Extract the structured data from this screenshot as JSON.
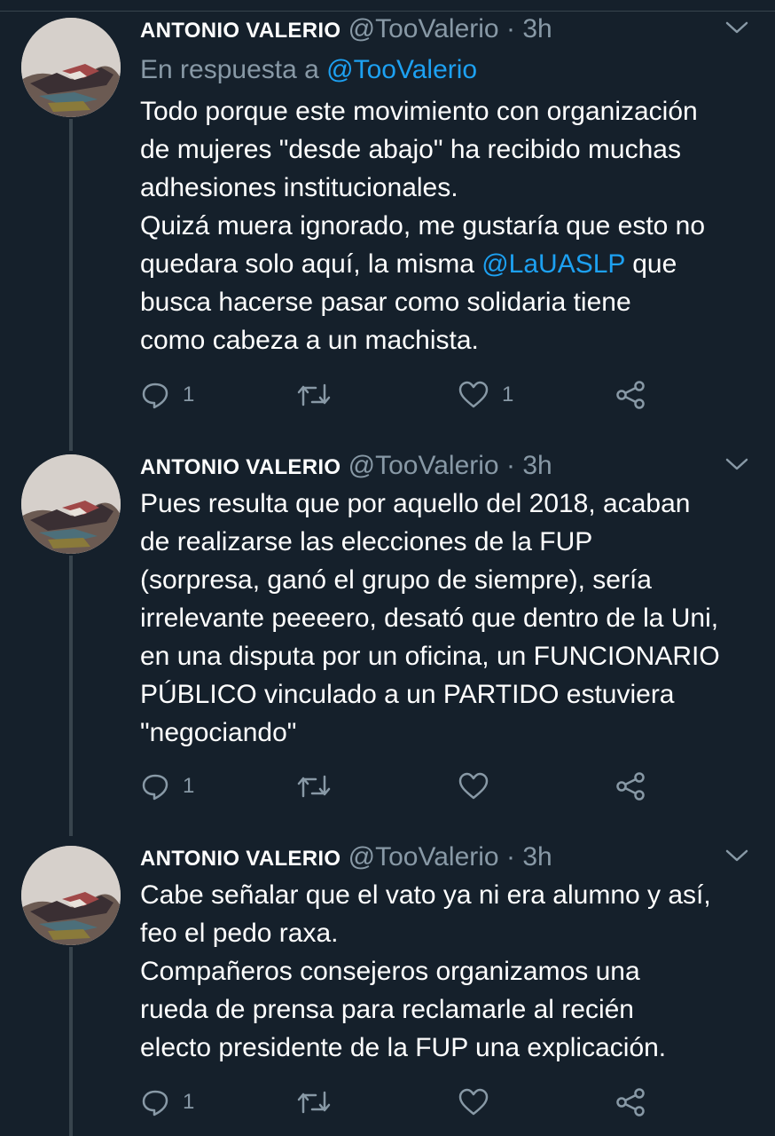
{
  "tweets": [
    {
      "author_name": "ANTONIO VALERIO",
      "handle": "@TooValerio",
      "separator": "·",
      "time": "3h",
      "reply_prefix": "En respuesta a",
      "reply_to": "@TooValerio",
      "text_part1": "Todo porque este movimiento con organización\nde mujeres \"desde abajo\" ha recibido muchas\nadhesiones institucionales.\nQuizá muera ignorado, me gustaría que esto no\nquedara solo aquí, la misma ",
      "mention": "@LaUASLP",
      "text_part2": " que\nbusca hacerse pasar como solidaria tiene\ncomo cabeza a un machista.",
      "reply_count": "1",
      "retweet_count": "",
      "like_count": "1"
    },
    {
      "author_name": "ANTONIO VALERIO",
      "handle": "@TooValerio",
      "separator": "·",
      "time": "3h",
      "text": "Pues resulta que por aquello del 2018, acaban\nde realizarse las elecciones de la FUP\n(sorpresa, ganó el grupo de siempre), sería\nirrelevante peeeero, desató que dentro de la Uni,\nen una disputa por un oficina, un FUNCIONARIO\nPÚBLICO vinculado a un PARTIDO estuviera\n\"negociando\"",
      "reply_count": "1",
      "retweet_count": "",
      "like_count": ""
    },
    {
      "author_name": "ANTONIO VALERIO",
      "handle": "@TooValerio",
      "separator": "·",
      "time": "3h",
      "text": "Cabe señalar que el vato ya ni era alumno y así,\nfeo el pedo raxa.\nCompañeros consejeros organizamos una\nrueda de prensa para reclamarle al recién\nelecto presidente de la FUP una explicación.",
      "reply_count": "1",
      "retweet_count": "",
      "like_count": ""
    }
  ],
  "icons": {
    "reply": "reply-icon",
    "retweet": "retweet-icon",
    "like": "heart-icon",
    "share": "share-icon",
    "menu": "chevron-down-icon"
  },
  "colors": {
    "background": "#15202b",
    "text": "#ffffff",
    "muted": "#8899a6",
    "link": "#1da1f2",
    "divider": "#38444d"
  }
}
